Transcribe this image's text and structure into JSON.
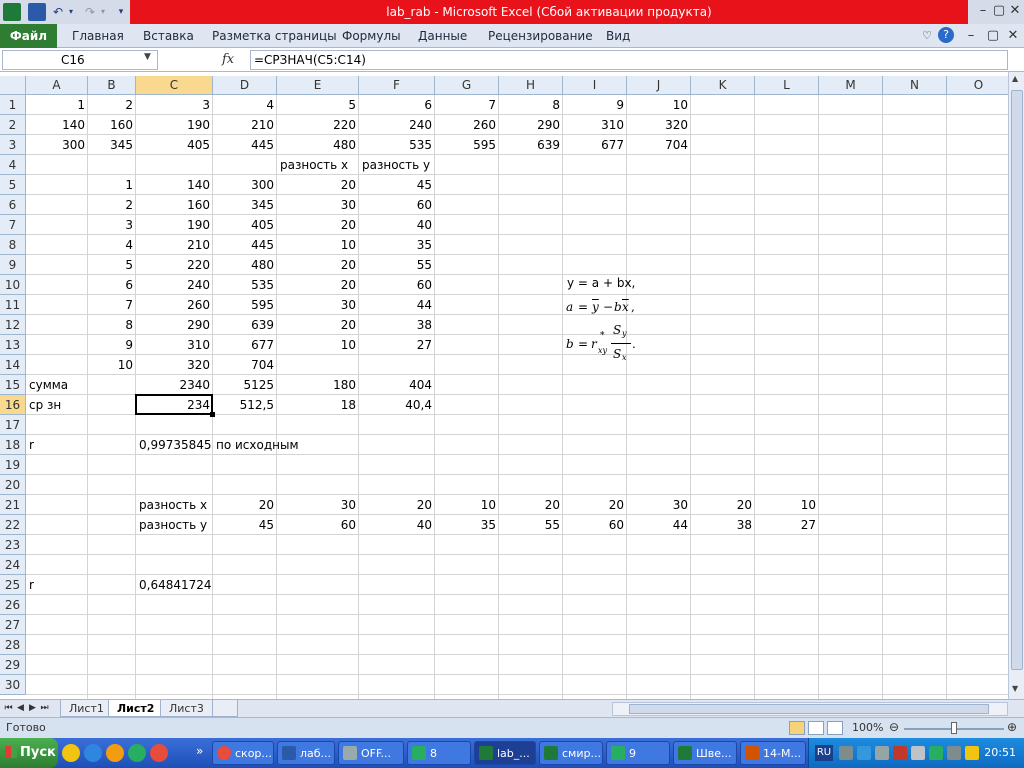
{
  "window": {
    "title": "lab_rab  -  Microsoft Excel (Сбой активации продукта)"
  },
  "ribbon": {
    "file_tab": "Файл",
    "tabs": [
      "Главная",
      "Вставка",
      "Разметка страницы",
      "Формулы",
      "Данные",
      "Рецензирование",
      "Вид"
    ]
  },
  "formula_bar": {
    "name_box": "C16",
    "fx": "fx",
    "formula": "=СРЗНАЧ(C5:C14)"
  },
  "grid": {
    "columns": [
      "A",
      "B",
      "C",
      "D",
      "E",
      "F",
      "G",
      "H",
      "I",
      "J",
      "K",
      "L",
      "M",
      "N",
      "O"
    ],
    "rows": [
      "1",
      "2",
      "3",
      "4",
      "5",
      "6",
      "7",
      "8",
      "9",
      "10",
      "11",
      "12",
      "13",
      "14",
      "15",
      "16",
      "17",
      "18",
      "19",
      "20",
      "21",
      "22",
      "23",
      "24",
      "25",
      "26",
      "27",
      "28",
      "29",
      "30"
    ],
    "active_col": "C",
    "active_row": "16",
    "cells": [
      {
        "col": "A",
        "row": 1,
        "v": "1",
        "t": "num"
      },
      {
        "col": "B",
        "row": 1,
        "v": "2",
        "t": "num"
      },
      {
        "col": "C",
        "row": 1,
        "v": "3",
        "t": "num"
      },
      {
        "col": "D",
        "row": 1,
        "v": "4",
        "t": "num"
      },
      {
        "col": "E",
        "row": 1,
        "v": "5",
        "t": "num"
      },
      {
        "col": "F",
        "row": 1,
        "v": "6",
        "t": "num"
      },
      {
        "col": "G",
        "row": 1,
        "v": "7",
        "t": "num"
      },
      {
        "col": "H",
        "row": 1,
        "v": "8",
        "t": "num"
      },
      {
        "col": "I",
        "row": 1,
        "v": "9",
        "t": "num"
      },
      {
        "col": "J",
        "row": 1,
        "v": "10",
        "t": "num"
      },
      {
        "col": "A",
        "row": 2,
        "v": "140",
        "t": "num"
      },
      {
        "col": "B",
        "row": 2,
        "v": "160",
        "t": "num"
      },
      {
        "col": "C",
        "row": 2,
        "v": "190",
        "t": "num"
      },
      {
        "col": "D",
        "row": 2,
        "v": "210",
        "t": "num"
      },
      {
        "col": "E",
        "row": 2,
        "v": "220",
        "t": "num"
      },
      {
        "col": "F",
        "row": 2,
        "v": "240",
        "t": "num"
      },
      {
        "col": "G",
        "row": 2,
        "v": "260",
        "t": "num"
      },
      {
        "col": "H",
        "row": 2,
        "v": "290",
        "t": "num"
      },
      {
        "col": "I",
        "row": 2,
        "v": "310",
        "t": "num"
      },
      {
        "col": "J",
        "row": 2,
        "v": "320",
        "t": "num"
      },
      {
        "col": "A",
        "row": 3,
        "v": "300",
        "t": "num"
      },
      {
        "col": "B",
        "row": 3,
        "v": "345",
        "t": "num"
      },
      {
        "col": "C",
        "row": 3,
        "v": "405",
        "t": "num"
      },
      {
        "col": "D",
        "row": 3,
        "v": "445",
        "t": "num"
      },
      {
        "col": "E",
        "row": 3,
        "v": "480",
        "t": "num"
      },
      {
        "col": "F",
        "row": 3,
        "v": "535",
        "t": "num"
      },
      {
        "col": "G",
        "row": 3,
        "v": "595",
        "t": "num"
      },
      {
        "col": "H",
        "row": 3,
        "v": "639",
        "t": "num"
      },
      {
        "col": "I",
        "row": 3,
        "v": "677",
        "t": "num"
      },
      {
        "col": "J",
        "row": 3,
        "v": "704",
        "t": "num"
      },
      {
        "col": "E",
        "row": 4,
        "v": "разность х",
        "t": "txt"
      },
      {
        "col": "F",
        "row": 4,
        "v": "разность у",
        "t": "txt"
      },
      {
        "col": "B",
        "row": 5,
        "v": "1",
        "t": "num"
      },
      {
        "col": "C",
        "row": 5,
        "v": "140",
        "t": "num"
      },
      {
        "col": "D",
        "row": 5,
        "v": "300",
        "t": "num"
      },
      {
        "col": "E",
        "row": 5,
        "v": "20",
        "t": "num"
      },
      {
        "col": "F",
        "row": 5,
        "v": "45",
        "t": "num"
      },
      {
        "col": "B",
        "row": 6,
        "v": "2",
        "t": "num"
      },
      {
        "col": "C",
        "row": 6,
        "v": "160",
        "t": "num"
      },
      {
        "col": "D",
        "row": 6,
        "v": "345",
        "t": "num"
      },
      {
        "col": "E",
        "row": 6,
        "v": "30",
        "t": "num"
      },
      {
        "col": "F",
        "row": 6,
        "v": "60",
        "t": "num"
      },
      {
        "col": "B",
        "row": 7,
        "v": "3",
        "t": "num"
      },
      {
        "col": "C",
        "row": 7,
        "v": "190",
        "t": "num"
      },
      {
        "col": "D",
        "row": 7,
        "v": "405",
        "t": "num"
      },
      {
        "col": "E",
        "row": 7,
        "v": "20",
        "t": "num"
      },
      {
        "col": "F",
        "row": 7,
        "v": "40",
        "t": "num"
      },
      {
        "col": "B",
        "row": 8,
        "v": "4",
        "t": "num"
      },
      {
        "col": "C",
        "row": 8,
        "v": "210",
        "t": "num"
      },
      {
        "col": "D",
        "row": 8,
        "v": "445",
        "t": "num"
      },
      {
        "col": "E",
        "row": 8,
        "v": "10",
        "t": "num"
      },
      {
        "col": "F",
        "row": 8,
        "v": "35",
        "t": "num"
      },
      {
        "col": "B",
        "row": 9,
        "v": "5",
        "t": "num"
      },
      {
        "col": "C",
        "row": 9,
        "v": "220",
        "t": "num"
      },
      {
        "col": "D",
        "row": 9,
        "v": "480",
        "t": "num"
      },
      {
        "col": "E",
        "row": 9,
        "v": "20",
        "t": "num"
      },
      {
        "col": "F",
        "row": 9,
        "v": "55",
        "t": "num"
      },
      {
        "col": "B",
        "row": 10,
        "v": "6",
        "t": "num"
      },
      {
        "col": "C",
        "row": 10,
        "v": "240",
        "t": "num"
      },
      {
        "col": "D",
        "row": 10,
        "v": "535",
        "t": "num"
      },
      {
        "col": "E",
        "row": 10,
        "v": "20",
        "t": "num"
      },
      {
        "col": "F",
        "row": 10,
        "v": "60",
        "t": "num"
      },
      {
        "col": "B",
        "row": 11,
        "v": "7",
        "t": "num"
      },
      {
        "col": "C",
        "row": 11,
        "v": "260",
        "t": "num"
      },
      {
        "col": "D",
        "row": 11,
        "v": "595",
        "t": "num"
      },
      {
        "col": "E",
        "row": 11,
        "v": "30",
        "t": "num"
      },
      {
        "col": "F",
        "row": 11,
        "v": "44",
        "t": "num"
      },
      {
        "col": "B",
        "row": 12,
        "v": "8",
        "t": "num"
      },
      {
        "col": "C",
        "row": 12,
        "v": "290",
        "t": "num"
      },
      {
        "col": "D",
        "row": 12,
        "v": "639",
        "t": "num"
      },
      {
        "col": "E",
        "row": 12,
        "v": "20",
        "t": "num"
      },
      {
        "col": "F",
        "row": 12,
        "v": "38",
        "t": "num"
      },
      {
        "col": "B",
        "row": 13,
        "v": "9",
        "t": "num"
      },
      {
        "col": "C",
        "row": 13,
        "v": "310",
        "t": "num"
      },
      {
        "col": "D",
        "row": 13,
        "v": "677",
        "t": "num"
      },
      {
        "col": "E",
        "row": 13,
        "v": "10",
        "t": "num"
      },
      {
        "col": "F",
        "row": 13,
        "v": "27",
        "t": "num"
      },
      {
        "col": "B",
        "row": 14,
        "v": "10",
        "t": "num"
      },
      {
        "col": "C",
        "row": 14,
        "v": "320",
        "t": "num"
      },
      {
        "col": "D",
        "row": 14,
        "v": "704",
        "t": "num"
      },
      {
        "col": "A",
        "row": 15,
        "v": "сумма",
        "t": "txt"
      },
      {
        "col": "C",
        "row": 15,
        "v": "2340",
        "t": "num"
      },
      {
        "col": "D",
        "row": 15,
        "v": "5125",
        "t": "num"
      },
      {
        "col": "E",
        "row": 15,
        "v": "180",
        "t": "num"
      },
      {
        "col": "F",
        "row": 15,
        "v": "404",
        "t": "num"
      },
      {
        "col": "A",
        "row": 16,
        "v": "ср зн",
        "t": "txt"
      },
      {
        "col": "C",
        "row": 16,
        "v": "234",
        "t": "num"
      },
      {
        "col": "D",
        "row": 16,
        "v": "512,5",
        "t": "num"
      },
      {
        "col": "E",
        "row": 16,
        "v": "18",
        "t": "num"
      },
      {
        "col": "F",
        "row": 16,
        "v": "40,4",
        "t": "num"
      },
      {
        "col": "A",
        "row": 18,
        "v": "r",
        "t": "txt"
      },
      {
        "col": "C",
        "row": 18,
        "v": "0,99735845",
        "t": "num"
      },
      {
        "col": "D",
        "row": 18,
        "v": "по исходным",
        "t": "txt"
      },
      {
        "col": "C",
        "row": 21,
        "v": "разность х",
        "t": "txt"
      },
      {
        "col": "D",
        "row": 21,
        "v": "20",
        "t": "num"
      },
      {
        "col": "E",
        "row": 21,
        "v": "30",
        "t": "num"
      },
      {
        "col": "F",
        "row": 21,
        "v": "20",
        "t": "num"
      },
      {
        "col": "G",
        "row": 21,
        "v": "10",
        "t": "num"
      },
      {
        "col": "H",
        "row": 21,
        "v": "20",
        "t": "num"
      },
      {
        "col": "I",
        "row": 21,
        "v": "20",
        "t": "num"
      },
      {
        "col": "J",
        "row": 21,
        "v": "30",
        "t": "num"
      },
      {
        "col": "K",
        "row": 21,
        "v": "20",
        "t": "num"
      },
      {
        "col": "L",
        "row": 21,
        "v": "10",
        "t": "num"
      },
      {
        "col": "C",
        "row": 22,
        "v": "разность у",
        "t": "txt"
      },
      {
        "col": "D",
        "row": 22,
        "v": "45",
        "t": "num"
      },
      {
        "col": "E",
        "row": 22,
        "v": "60",
        "t": "num"
      },
      {
        "col": "F",
        "row": 22,
        "v": "40",
        "t": "num"
      },
      {
        "col": "G",
        "row": 22,
        "v": "35",
        "t": "num"
      },
      {
        "col": "H",
        "row": 22,
        "v": "55",
        "t": "num"
      },
      {
        "col": "I",
        "row": 22,
        "v": "60",
        "t": "num"
      },
      {
        "col": "J",
        "row": 22,
        "v": "44",
        "t": "num"
      },
      {
        "col": "K",
        "row": 22,
        "v": "38",
        "t": "num"
      },
      {
        "col": "L",
        "row": 22,
        "v": "27",
        "t": "num"
      },
      {
        "col": "A",
        "row": 25,
        "v": "r",
        "t": "txt"
      },
      {
        "col": "C",
        "row": 25,
        "v": "0,64841724",
        "t": "num"
      }
    ]
  },
  "equations": {
    "line1": "y = a + bx,",
    "line2_a": "a",
    "line2_eq": "=",
    "line2_y": "y",
    "line2_minus": "−",
    "line2_b": "b",
    "line2_x": "x",
    "line2_end": ",",
    "line3_b": "b",
    "line3_eq": "=",
    "line3_r": "r",
    "line3_sup": "*",
    "line3_sub": "xy",
    "line3_num": "S",
    "line3_num_sub": "y",
    "line3_den": "S",
    "line3_den_sub": "x",
    "line3_end": "."
  },
  "sheets": {
    "tabs": [
      "Лист1",
      "Лист2",
      "Лист3"
    ],
    "active": "Лист2"
  },
  "status": {
    "ready": "Готово",
    "zoom": "100%"
  },
  "taskbar": {
    "start": "Пуск",
    "tasks": [
      "скор...",
      "лаб...",
      "OFF...",
      "8",
      "lab_...",
      "смир...",
      "9",
      "Шве...",
      "14-М..."
    ],
    "lang": "RU",
    "clock": "20:51"
  },
  "colors": {
    "title_red": "#e8121a",
    "file_tab_green": "#2e7d32",
    "header_active": "#f8d98f"
  }
}
